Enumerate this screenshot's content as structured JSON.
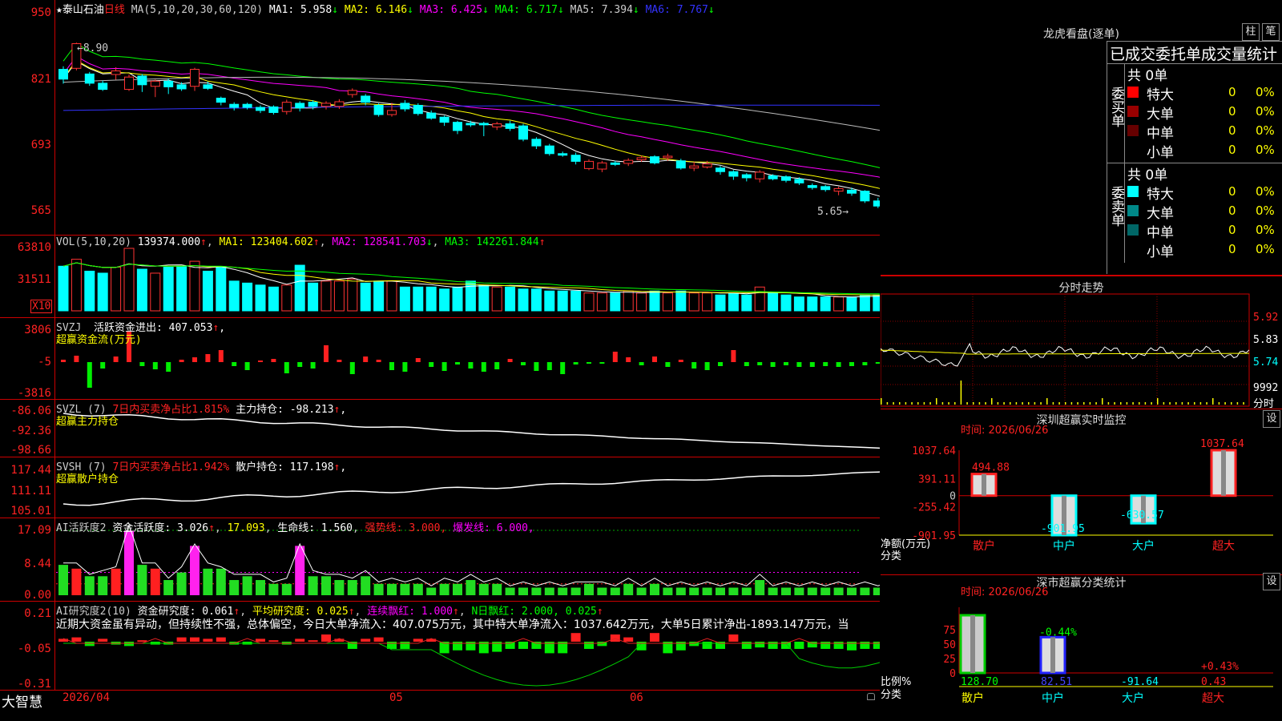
{
  "stock": {
    "star": "★",
    "name": "泰山石油",
    "period": "日线"
  },
  "main": {
    "ma_label": "MA(5,10,20,30,60,120)",
    "ma": [
      {
        "label": "MA1:",
        "value": "5.958",
        "arrow": "↓",
        "color": "#ffffff"
      },
      {
        "label": "MA2:",
        "value": "6.146",
        "arrow": "↓",
        "color": "#ffff00"
      },
      {
        "label": "MA3:",
        "value": "6.425",
        "arrow": "↓",
        "color": "#ff00ff"
      },
      {
        "label": "MA4:",
        "value": "6.717",
        "arrow": "↓",
        "color": "#00ff00"
      },
      {
        "label": "MA5:",
        "value": "7.394",
        "arrow": "↓",
        "color": "#cccccc"
      },
      {
        "label": "MA6:",
        "value": "7.767",
        "arrow": "↓",
        "color": "#3333ff"
      }
    ],
    "y_ticks": [
      "950",
      "821",
      "693",
      "565"
    ],
    "high_label": "←8.90",
    "low_label": "5.65→"
  },
  "vol": {
    "header": {
      "name": "VOL(5,10,20)",
      "value": "139374.000",
      "arrow": "↑",
      "ma1": "MA1: 123404.602",
      "ma1_arrow": "↑",
      "ma2": "MA2: 128541.703",
      "ma2_arrow": "↓",
      "ma3": "MA3: 142261.844",
      "ma3_arrow": "↑"
    },
    "y_ticks": [
      "63810",
      "31511"
    ],
    "unit": "X10"
  },
  "svzj": {
    "name": "SVZJ",
    "label": "活跃资金进出:",
    "value": "407.053",
    "arrow": "↑",
    "sep": ",",
    "sub": "超赢资金流(万元)",
    "y_ticks": [
      "3806",
      "-5",
      "-3816"
    ]
  },
  "svzl": {
    "name": "SVZL (7)",
    "ratio": "7日内买卖净占比1.815%",
    "label": "主力持仓:",
    "value": "-98.213",
    "arrow": "↑",
    "sep": ",",
    "sub": "超赢主力持仓",
    "y_ticks": [
      "-86.06",
      "-92.36",
      "-98.66"
    ]
  },
  "svsh": {
    "name": "SVSH (7)",
    "ratio": "7日内买卖净占比1.942%",
    "label": "散户持仓:",
    "value": "117.198",
    "arrow": "↑",
    "sep": ",",
    "sub": "超赢散户持仓",
    "y_ticks": [
      "117.44",
      "111.11",
      "105.01"
    ]
  },
  "ai1": {
    "name": "AI活跃度2",
    "label": "资金活跃度:",
    "value": "3.026",
    "arrow": "↑",
    "v2": "17.093",
    "life": "生命线: 1.560",
    "strong": "强势线: 3.000,",
    "burst": "爆发线: 6.000,",
    "y_ticks": [
      "17.09",
      "8.44",
      "0.00"
    ]
  },
  "ai2": {
    "name": "AI研究度2(10)",
    "label": "资金研究度:",
    "value": "0.061",
    "arrow": "↑",
    "avg": "平均研究度: 0.025",
    "avg_arrow": "↑",
    "lx": "连续飘红: 1.000",
    "lx_arrow": "↑",
    "nr": "N日飘红: 2.000, 0.025",
    "nr_arrow": "↑",
    "comment": "近期大资金虽有异动，但持续性不强，总体偏空，今日大单净流入：407.075万元，其中特大单净流入：1037.642万元，大单5日累计净出-1893.147万元，当",
    "y_ticks": [
      "0.21",
      "-0.05",
      "-0.31"
    ]
  },
  "footer": {
    "brand": "大智慧",
    "dates": [
      "2026/04",
      "05",
      "06"
    ]
  },
  "lhkp": {
    "title": "龙虎看盘(逐单)",
    "btn1": "柱",
    "btn2": "笔",
    "subtitle": "已成交委托单成交量统计",
    "buy": {
      "side": "委买单",
      "total": "共 0单",
      "rows": [
        {
          "name": "特大",
          "v": "0",
          "p": "0%",
          "color": "#ff0000"
        },
        {
          "name": "大单",
          "v": "0",
          "p": "0%",
          "color": "#990000"
        },
        {
          "name": "中单",
          "v": "0",
          "p": "0%",
          "color": "#660000"
        },
        {
          "name": "小单",
          "v": "0",
          "p": "0%",
          "color": "#000000"
        }
      ]
    },
    "sell": {
      "side": "委卖单",
      "total": "共 0单",
      "rows": [
        {
          "name": "特大",
          "v": "0",
          "p": "0%",
          "color": "#00ffff"
        },
        {
          "name": "大单",
          "v": "0",
          "p": "0%",
          "color": "#008888"
        },
        {
          "name": "中单",
          "v": "0",
          "p": "0%",
          "color": "#006666"
        },
        {
          "name": "小单",
          "v": "0",
          "p": "0%",
          "color": "#000000"
        }
      ]
    }
  },
  "fszs": {
    "title": "分时走势",
    "y_ticks": [
      "5.92",
      "5.83",
      "5.74"
    ],
    "vol_tick": "9992",
    "vol_label": "分时"
  },
  "szcy": {
    "title": "深圳超赢实时监控",
    "set": "设",
    "time": "时间: 2026/06/26",
    "y_ticks": [
      "1037.64",
      "391.11",
      "0",
      "-255.42",
      "-901.95"
    ],
    "ylabel": "净额(万元)",
    "xlabel": "分类",
    "cats": [
      "散户",
      "中户",
      "大户",
      "超大"
    ],
    "values_text": [
      "494.88",
      "-901.95",
      "-630.57",
      "1037.64"
    ],
    "chart_data": {
      "type": "bar",
      "categories": [
        "散户",
        "中户",
        "大户",
        "超大"
      ],
      "values": [
        494.88,
        -901.95,
        -630.57,
        1037.64
      ],
      "ylim": [
        -901.95,
        1037.64
      ]
    }
  },
  "ssfl": {
    "title": "深市超赢分类统计",
    "set": "设",
    "time": "时间: 2026/06/26",
    "y_ticks": [
      "75",
      "50",
      "25",
      "0"
    ],
    "ylabel": "比例%",
    "xlabel": "分类",
    "cats": [
      "散户",
      "中户",
      "大户",
      "超大"
    ],
    "pct_labels": [
      "",
      "-0.44%",
      "",
      "+0.43%"
    ],
    "values_text": [
      "128.70",
      "82.51",
      "-91.64",
      "0.43"
    ],
    "chart_data": {
      "type": "bar",
      "categories": [
        "散户",
        "中户",
        "大户",
        "超大"
      ],
      "values": [
        128.7,
        82.51,
        -91.64,
        0.43
      ],
      "ylim": [
        0,
        100
      ]
    }
  },
  "candles": [
    {
      "o": 8.4,
      "c": 8.21,
      "h": 8.46,
      "l": 8.12
    },
    {
      "o": 8.42,
      "c": 8.9,
      "h": 8.92,
      "l": 8.38
    },
    {
      "o": 8.31,
      "c": 8.13,
      "h": 8.35,
      "l": 8.08
    },
    {
      "o": 8.13,
      "c": 8.01,
      "h": 8.18,
      "l": 7.98
    },
    {
      "o": 8.3,
      "c": 8.37,
      "h": 8.44,
      "l": 8.2
    },
    {
      "o": 8.01,
      "c": 8.25,
      "h": 8.3,
      "l": 7.98
    },
    {
      "o": 8.27,
      "c": 8.1,
      "h": 8.31,
      "l": 7.96
    },
    {
      "o": 8.07,
      "c": 8.17,
      "h": 8.2,
      "l": 7.86
    },
    {
      "o": 8.17,
      "c": 8.06,
      "h": 8.22,
      "l": 7.92
    },
    {
      "o": 8.1,
      "c": 8.02,
      "h": 8.15,
      "l": 7.98
    },
    {
      "o": 8.07,
      "c": 8.4,
      "h": 8.43,
      "l": 7.98
    },
    {
      "o": 8.1,
      "c": 8.03,
      "h": 8.16,
      "l": 8.0
    },
    {
      "o": 7.84,
      "c": 7.76,
      "h": 7.87,
      "l": 7.7
    },
    {
      "o": 7.72,
      "c": 7.66,
      "h": 7.76,
      "l": 7.6
    },
    {
      "o": 7.72,
      "c": 7.66,
      "h": 7.75,
      "l": 7.62
    },
    {
      "o": 7.66,
      "c": 7.6,
      "h": 7.7,
      "l": 7.55
    },
    {
      "o": 7.67,
      "c": 7.56,
      "h": 7.7,
      "l": 7.52
    },
    {
      "o": 7.58,
      "c": 7.76,
      "h": 7.81,
      "l": 7.52
    },
    {
      "o": 7.74,
      "c": 7.65,
      "h": 7.78,
      "l": 7.58
    },
    {
      "o": 7.76,
      "c": 7.68,
      "h": 7.8,
      "l": 7.62
    },
    {
      "o": 7.68,
      "c": 7.74,
      "h": 7.78,
      "l": 7.62
    },
    {
      "o": 7.68,
      "c": 7.77,
      "h": 7.82,
      "l": 7.63
    },
    {
      "o": 7.91,
      "c": 7.99,
      "h": 8.03,
      "l": 7.85
    },
    {
      "o": 7.88,
      "c": 7.76,
      "h": 7.92,
      "l": 7.7
    },
    {
      "o": 7.7,
      "c": 7.52,
      "h": 7.74,
      "l": 7.48
    },
    {
      "o": 7.52,
      "c": 7.6,
      "h": 7.75,
      "l": 7.48
    },
    {
      "o": 7.74,
      "c": 7.63,
      "h": 7.8,
      "l": 7.58
    },
    {
      "o": 7.7,
      "c": 7.54,
      "h": 7.74,
      "l": 7.5
    },
    {
      "o": 7.55,
      "c": 7.45,
      "h": 7.6,
      "l": 7.42
    },
    {
      "o": 7.47,
      "c": 7.37,
      "h": 7.5,
      "l": 7.3
    },
    {
      "o": 7.37,
      "c": 7.21,
      "h": 7.4,
      "l": 7.14
    },
    {
      "o": 7.35,
      "c": 7.32,
      "h": 7.4,
      "l": 7.28
    },
    {
      "o": 7.35,
      "c": 7.32,
      "h": 7.38,
      "l": 7.1
    },
    {
      "o": 7.28,
      "c": 7.34,
      "h": 7.38,
      "l": 7.22
    },
    {
      "o": 7.34,
      "c": 7.25,
      "h": 7.4,
      "l": 7.2
    },
    {
      "o": 7.3,
      "c": 7.04,
      "h": 7.34,
      "l": 7.0
    },
    {
      "o": 7.04,
      "c": 6.91,
      "h": 7.08,
      "l": 6.85
    },
    {
      "o": 6.91,
      "c": 6.76,
      "h": 6.95,
      "l": 6.72
    },
    {
      "o": 6.76,
      "c": 6.73,
      "h": 6.8,
      "l": 6.7
    },
    {
      "o": 6.73,
      "c": 6.61,
      "h": 6.78,
      "l": 6.55
    },
    {
      "o": 6.47,
      "c": 6.61,
      "h": 6.65,
      "l": 6.44
    },
    {
      "o": 6.46,
      "c": 6.58,
      "h": 6.62,
      "l": 6.4
    },
    {
      "o": 6.58,
      "c": 6.55,
      "h": 6.62,
      "l": 6.52
    },
    {
      "o": 6.57,
      "c": 6.63,
      "h": 6.67,
      "l": 6.52
    },
    {
      "o": 6.64,
      "c": 6.68,
      "h": 6.72,
      "l": 6.6
    },
    {
      "o": 6.7,
      "c": 6.58,
      "h": 6.73,
      "l": 6.55
    },
    {
      "o": 6.68,
      "c": 6.71,
      "h": 6.76,
      "l": 6.62
    },
    {
      "o": 6.62,
      "c": 6.48,
      "h": 6.66,
      "l": 6.45
    },
    {
      "o": 6.48,
      "c": 6.52,
      "h": 6.6,
      "l": 6.42
    },
    {
      "o": 6.5,
      "c": 6.56,
      "h": 6.62,
      "l": 6.47
    },
    {
      "o": 6.48,
      "c": 6.41,
      "h": 6.52,
      "l": 6.35
    },
    {
      "o": 6.41,
      "c": 6.32,
      "h": 6.44,
      "l": 6.25
    },
    {
      "o": 6.35,
      "c": 6.29,
      "h": 6.38,
      "l": 6.22
    },
    {
      "o": 6.27,
      "c": 6.4,
      "h": 6.44,
      "l": 6.2
    },
    {
      "o": 6.33,
      "c": 6.27,
      "h": 6.36,
      "l": 6.24
    },
    {
      "o": 6.31,
      "c": 6.24,
      "h": 6.34,
      "l": 6.2
    },
    {
      "o": 6.26,
      "c": 6.19,
      "h": 6.3,
      "l": 6.15
    },
    {
      "o": 6.14,
      "c": 6.1,
      "h": 6.18,
      "l": 6.06
    },
    {
      "o": 6.12,
      "c": 6.06,
      "h": 6.15,
      "l": 6.02
    },
    {
      "o": 6.03,
      "c": 6.08,
      "h": 6.12,
      "l": 5.95
    },
    {
      "o": 6.05,
      "c": 5.99,
      "h": 6.1,
      "l": 5.94
    },
    {
      "o": 6.03,
      "c": 5.84,
      "h": 6.05,
      "l": 5.8
    },
    {
      "o": 5.84,
      "c": 5.74,
      "h": 5.9,
      "l": 5.7
    },
    {
      "o": 5.76,
      "c": 5.65,
      "h": 5.78,
      "l": 5.65
    }
  ],
  "vols": [
    45,
    52,
    40,
    38,
    44,
    63,
    42,
    38,
    44,
    45,
    50,
    40,
    44,
    30,
    28,
    26,
    24,
    26,
    46,
    28,
    30,
    30,
    32,
    28,
    30,
    30,
    24,
    24,
    24,
    22,
    24,
    30,
    26,
    24,
    24,
    22,
    22,
    20,
    20,
    20,
    18,
    18,
    18,
    20,
    18,
    20,
    18,
    20,
    18,
    18,
    16,
    18,
    16,
    24,
    18,
    16,
    14,
    14,
    14,
    14,
    14,
    16,
    16,
    14,
    16
  ],
  "svzj_vals": [
    0.3,
    0.8,
    -3.2,
    -0.8,
    0.7,
    3.8,
    -0.5,
    -0.9,
    -1.2,
    0.3,
    0.6,
    1.0,
    1.5,
    -0.5,
    -1.0,
    0.2,
    0.4,
    -1.4,
    -0.6,
    -0.8,
    2.1,
    0.3,
    -1.5,
    0.7,
    0.3,
    -1.0,
    -1.2,
    0.5,
    -0.6,
    -1.1,
    -0.3,
    -0.8,
    -1.2,
    -0.9,
    0.4,
    -0.4,
    -1.1,
    -1.0,
    -1.5,
    -0.3,
    -0.1,
    -0.2,
    1.3,
    0.6,
    -0.4,
    0.7,
    -0.6,
    0.3,
    -0.8,
    -1.0,
    -0.5,
    1.5,
    -0.5,
    -0.4,
    -0.6,
    -0.4,
    -0.6,
    -0.6,
    -0.5,
    -0.6,
    -0.5,
    -0.4,
    -0.2,
    -0.3,
    0.3
  ],
  "ai1_vals": [
    8,
    7,
    5,
    5,
    7,
    17,
    8,
    7,
    4,
    6,
    13,
    7,
    7,
    4,
    5,
    4,
    3,
    3,
    13,
    5,
    5,
    4,
    4,
    5,
    3,
    3,
    3,
    3,
    2,
    3,
    3,
    4,
    3,
    3,
    2,
    2,
    2,
    2,
    2,
    2,
    3,
    2,
    2,
    3,
    2,
    3,
    2,
    2,
    2,
    2,
    2,
    2,
    2,
    4,
    2,
    2,
    2,
    2,
    2,
    2,
    2,
    2,
    2,
    2,
    3
  ],
  "ai2_vals": [
    0.02,
    0.03,
    -0.03,
    0.02,
    -0.02,
    -0.03,
    0.01,
    -0.02,
    -0.02,
    0.03,
    0.03,
    0.02,
    0.03,
    -0.02,
    -0.02,
    0.02,
    0.01,
    -0.02,
    0.02,
    0.01,
    0.05,
    0.02,
    -0.05,
    0.02,
    0.03,
    -0.05,
    -0.05,
    0.02,
    0.02,
    -0.08,
    -0.06,
    -0.06,
    -0.08,
    -0.07,
    -0.05,
    -0.05,
    -0.05,
    -0.08,
    -0.08,
    0.06,
    -0.05,
    -0.03,
    0.05,
    0.03,
    -0.06,
    0.06,
    -0.08,
    -0.06,
    -0.03,
    -0.05,
    -0.05,
    0.05,
    -0.05,
    -0.04,
    -0.05,
    -0.05,
    -0.05,
    -0.04,
    -0.05,
    -0.05,
    -0.06,
    -0.05,
    -0.05,
    -0.04,
    0.06
  ]
}
